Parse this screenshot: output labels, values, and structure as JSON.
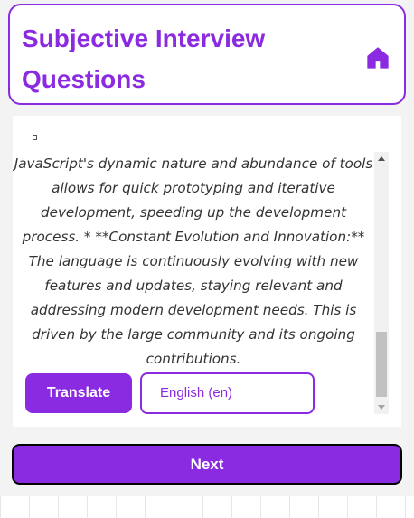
{
  "header": {
    "title": "Subjective Interview Questions",
    "home_icon": "home-icon"
  },
  "answer": {
    "text": "JavaScript's dynamic nature and abundance of tools allows for quick prototyping and iterative development, speeding up the development process. * **Constant Evolution and Innovation:** The language is continuously evolving with new features and updates, staying relevant and addressing modern development needs. This is driven by the large community and its ongoing contributions."
  },
  "translate_button": {
    "label": "Translate"
  },
  "language_select": {
    "value": "English (en)"
  },
  "next_button": {
    "label": "Next"
  },
  "colors": {
    "accent": "#8a2be2",
    "background": "#f3f3f3",
    "panel": "#ffffff"
  }
}
